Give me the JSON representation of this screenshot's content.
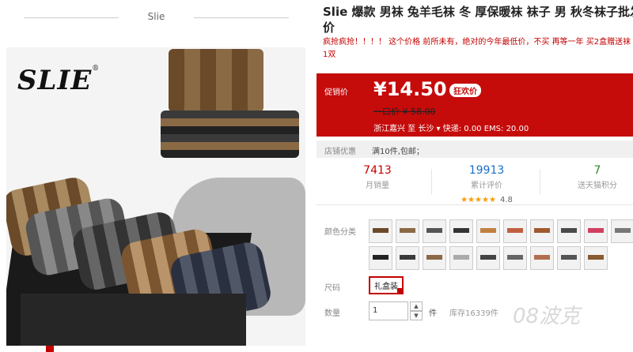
{
  "header": {
    "brand": "Slie"
  },
  "product": {
    "logo_text": "SLIE",
    "logo_mark": "®",
    "title_line1": "Slie 爆款 男袜 兔羊毛袜 冬 厚保暖袜 袜子 男 秋冬袜子批发",
    "title_line2": "价",
    "subtitle": "疯抢疯抢！！！！ 这个价格 前所未有，绝对的今年最低价，不买 再等一年 买2盒赠送袜1双"
  },
  "price": {
    "label": "促销价",
    "value": "¥14.50",
    "tag": "狂欢价",
    "original": "一口价 ¥ 58.00",
    "shipping": "浙江嘉兴 至  长沙 ▾   快递: 0.00 EMS: 20.00"
  },
  "promo": {
    "label": "店铺优惠",
    "text": "满10件,包邮；"
  },
  "stats": [
    {
      "num": "7413",
      "cap": "月销量",
      "color": "#c40000"
    },
    {
      "num": "19913",
      "cap": "累计评价",
      "color": "#1a6fc6",
      "stars": "★★★★★",
      "rating": "4.8"
    },
    {
      "num": "7",
      "cap": "送天猫积分",
      "color": "#2a8a2a"
    }
  ],
  "options": {
    "color_label": "颜色分类",
    "size_label": "尺码",
    "size_value": "礼盒装",
    "qty_label": "数量",
    "qty_value": "1",
    "qty_up": "▲",
    "qty_down": "▼",
    "unit": "件",
    "stock": "库存16339件"
  },
  "watermark": "08波克"
}
